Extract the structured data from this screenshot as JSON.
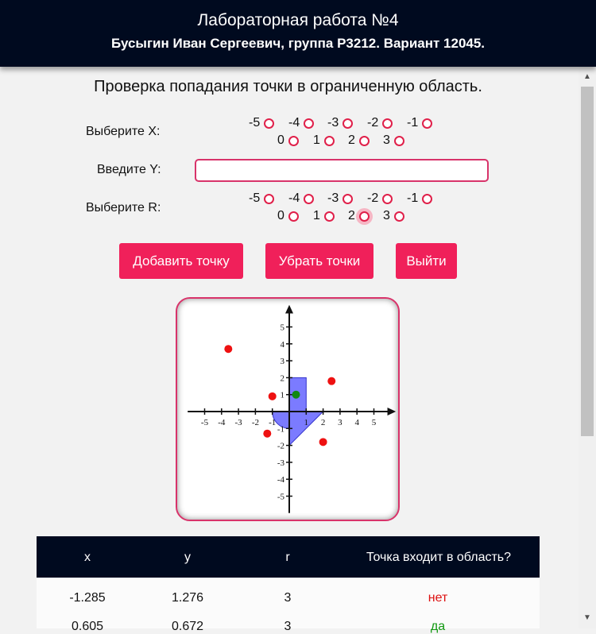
{
  "header": {
    "title": "Лабораторная работа №4",
    "subtitle": "Бусыгин Иван Сергеевич, группа Р3212. Вариант 12045."
  },
  "form": {
    "question": "Проверка попадания точки в ограниченную область.",
    "x_label": "Выберите X:",
    "y_label": "Введите Y:",
    "r_label": "Выберите R:",
    "y_value": "",
    "x_options": [
      "-5",
      "-4",
      "-3",
      "-2",
      "-1",
      "0",
      "1",
      "2",
      "3"
    ],
    "r_options": [
      "-5",
      "-4",
      "-3",
      "-2",
      "-1",
      "0",
      "1",
      "2",
      "3"
    ],
    "r_selected": "2"
  },
  "buttons": {
    "add": "Добавить точку",
    "clear": "Убрать точки",
    "exit": "Выйти"
  },
  "chart_data": {
    "type": "scatter",
    "xlim": [
      -5,
      5
    ],
    "ylim": [
      -5,
      5
    ],
    "x_ticks": [
      "-5",
      "-4",
      "-3",
      "-2",
      "-1",
      "1",
      "2",
      "3",
      "4",
      "5"
    ],
    "y_ticks": [
      "5",
      "4",
      "3",
      "2",
      "1",
      "-1",
      "-2",
      "-3",
      "-4",
      "-5"
    ],
    "region_color": "#7b7bff",
    "points": [
      {
        "x": -3.6,
        "y": 3.7,
        "hit": false
      },
      {
        "x": 2.5,
        "y": 1.8,
        "hit": false
      },
      {
        "x": -1.0,
        "y": 0.9,
        "hit": false
      },
      {
        "x": 0.4,
        "y": 1.0,
        "hit": true
      },
      {
        "x": -1.3,
        "y": -1.3,
        "hit": false
      },
      {
        "x": 2.0,
        "y": -1.8,
        "hit": false
      }
    ],
    "hit_color": "#118811",
    "miss_color": "#ee1111"
  },
  "table": {
    "headers": [
      "x",
      "y",
      "r",
      "Точка входит в область?"
    ],
    "rows": [
      {
        "x": "-1.285",
        "y": "1.276",
        "r": "3",
        "result": "нет",
        "hit": false
      },
      {
        "x": "0.605",
        "y": "0.672",
        "r": "3",
        "result": "да",
        "hit": true
      }
    ]
  },
  "icons": {
    "scroll_up": "triangle-up",
    "scroll_down": "triangle-down"
  }
}
